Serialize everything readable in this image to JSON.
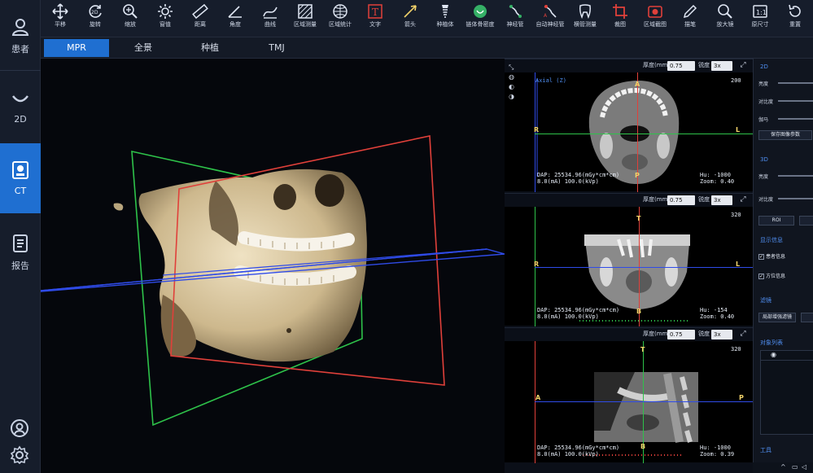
{
  "sidebar": {
    "items": [
      {
        "label": "患者",
        "icon": "patient-icon"
      },
      {
        "label": "2D",
        "icon": "panoramic-2d-icon"
      },
      {
        "label": "CT",
        "icon": "ct-icon"
      },
      {
        "label": "报告",
        "icon": "report-icon"
      }
    ],
    "bottom_icons": [
      "user-icon",
      "settings-icon"
    ]
  },
  "toolbar": {
    "tools": [
      {
        "label": "平移",
        "icon": "pan-icon"
      },
      {
        "label": "旋转",
        "icon": "rotate-2d-icon"
      },
      {
        "label": "缩放",
        "icon": "zoom-icon"
      },
      {
        "label": "窗值",
        "icon": "window-level-icon"
      },
      {
        "label": "距离",
        "icon": "ruler-icon"
      },
      {
        "label": "角度",
        "icon": "angle-icon"
      },
      {
        "label": "曲线",
        "icon": "curve-icon"
      },
      {
        "label": "区域测量",
        "icon": "area-measure-icon"
      },
      {
        "label": "区域统计",
        "icon": "area-stat-icon"
      },
      {
        "label": "文字",
        "icon": "text-icon"
      },
      {
        "label": "箭头",
        "icon": "arrow-icon"
      },
      {
        "label": "种植体",
        "icon": "implant-icon"
      },
      {
        "label": "链体骨密度",
        "icon": "bone-density-icon"
      },
      {
        "label": "神经管",
        "icon": "nerve-canal-icon"
      },
      {
        "label": "自动神经管",
        "icon": "auto-nerve-icon"
      },
      {
        "label": "横管测量",
        "icon": "tooth-measure-icon"
      },
      {
        "label": "裁图",
        "icon": "crop-icon"
      },
      {
        "label": "区域截图",
        "icon": "region-capture-icon"
      },
      {
        "label": "描笔",
        "icon": "pen-icon"
      },
      {
        "label": "放大镜",
        "icon": "magnifier-icon"
      },
      {
        "label": "原尺寸",
        "icon": "actual-size-icon"
      },
      {
        "label": "重置",
        "icon": "reset-icon"
      }
    ]
  },
  "tabs": [
    "MPR",
    "全景",
    "种植",
    "TMJ"
  ],
  "active_tab": "MPR",
  "views": [
    {
      "thickness_label": "厚度(mm)",
      "thickness": "0.75",
      "sharpness_label": "锐度",
      "sharpness": "3x",
      "title": "Axial (Z)",
      "slice": "200",
      "top": "A",
      "bottom": "P",
      "left": "R",
      "right": "L",
      "dap": "DAP: 25534.96(mGy*cm*cm)",
      "exposure": "8.0(mA) 100.0(kVp)",
      "hu": "Hu: -1000",
      "zoom": "Zoom: 0.40",
      "h_color": "#2ec24a",
      "v_color": "#e0403a"
    },
    {
      "thickness_label": "厚度(mm)",
      "thickness": "0.75",
      "sharpness_label": "锐度",
      "sharpness": "3x",
      "title": "",
      "slice": "320",
      "top": "T",
      "bottom": "B",
      "left": "R",
      "right": "L",
      "dap": "DAP: 25534.96(mGy*cm*cm)",
      "exposure": "8.0(mA) 100.0(kVp)",
      "hu": "Hu: -154",
      "zoom": "Zoom: 0.40",
      "h_color": "#2f4be8",
      "v_color": "#e0403a"
    },
    {
      "thickness_label": "厚度(mm)",
      "thickness": "0.75",
      "sharpness_label": "锐度",
      "sharpness": "3x",
      "title": "",
      "slice": "320",
      "top": "T",
      "bottom": "B",
      "left": "A",
      "right": "P",
      "dap": "DAP: 25534.96(mGy*cm*cm)",
      "exposure": "8.0(mA) 100.0(kVp)",
      "hu": "Hu: -1000",
      "zoom": "Zoom: 0.39",
      "h_color": "#2f4be8",
      "v_color": "#2ec24a"
    }
  ],
  "right_panel": {
    "section_2d": "2D",
    "brightness": "亮度",
    "contrast": "对比度",
    "gamma": "伽马",
    "save_params": "保存图像参数",
    "section_3d": "3D",
    "brightness_3d": "亮度",
    "contrast_3d": "对比度",
    "roi": "ROI",
    "section_display": "显示信息",
    "patient_info": "患者信息",
    "orientation_info": "方位信息",
    "section_filter": "滤镜",
    "local_enhance": "局部增强滤镜",
    "section_objects": "对象列表",
    "tools_label": "工具"
  }
}
